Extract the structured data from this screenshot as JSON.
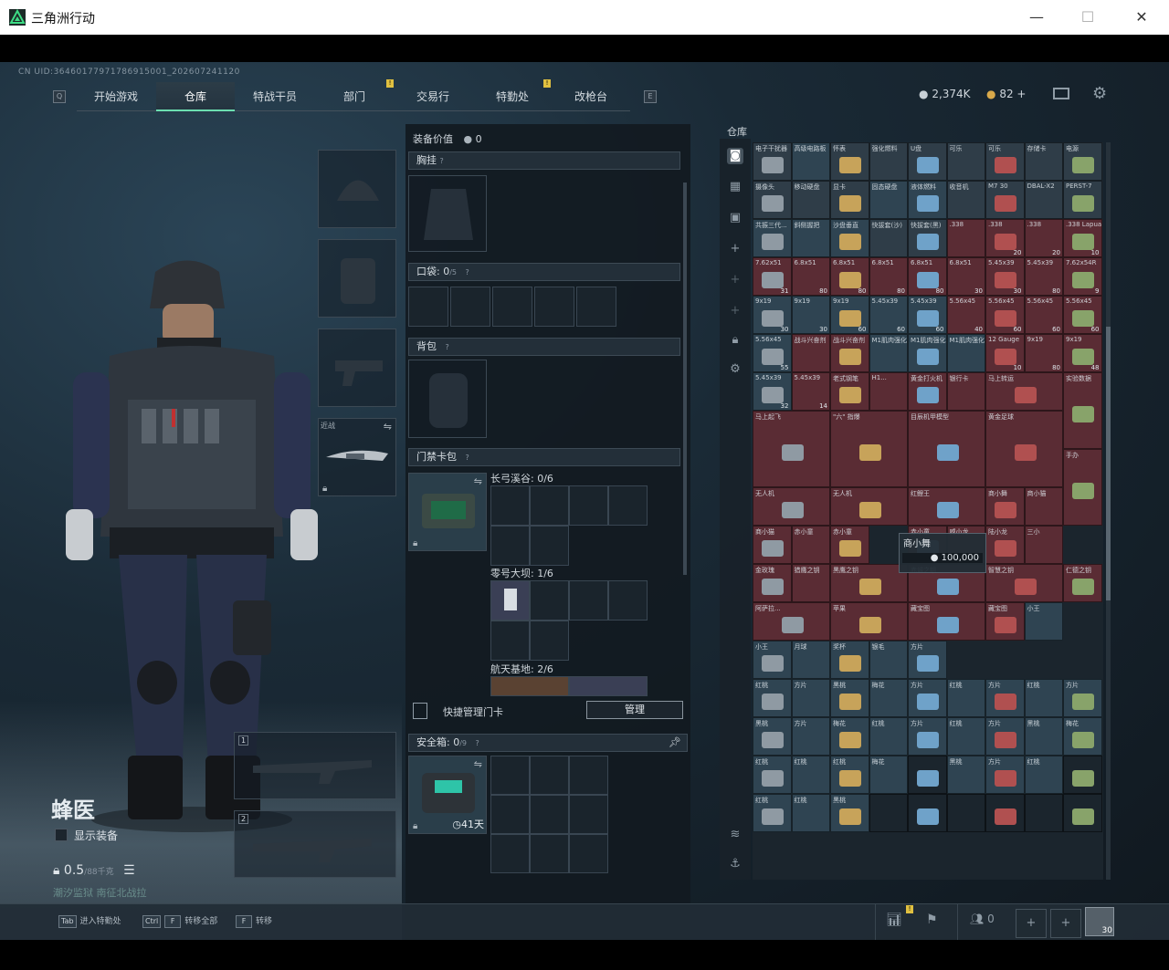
{
  "window": {
    "title": "三角洲行动",
    "minimize": "—",
    "maximize": "☐",
    "close": "✕"
  },
  "uid": "CN UID:36460177971786915001_202607241120",
  "nav": {
    "key_left": "Q",
    "key_right": "E",
    "tabs": [
      {
        "label": "开始游戏",
        "active": false
      },
      {
        "label": "仓库",
        "active": true
      },
      {
        "label": "特战干员",
        "active": false
      },
      {
        "label": "部门",
        "active": false
      },
      {
        "label": "交易行",
        "active": false
      },
      {
        "label": "特勤处",
        "active": false
      },
      {
        "label": "改枪台",
        "active": false
      }
    ],
    "badge": "!"
  },
  "currency": {
    "coins": "2,374K",
    "tickets": "82",
    "plus": "+"
  },
  "operator": {
    "name": "蜂医",
    "show_equipment": "显示装备",
    "weight": "0.5",
    "weight_max": "/88千克",
    "map": "潮汐监狱",
    "map2": "南征北战拉"
  },
  "equipment": {
    "melee_label": "近战",
    "slot1": "1",
    "slot2": "2"
  },
  "mid": {
    "value_label": "装备价值",
    "value": "0",
    "chest": "胸挂",
    "pocket": "口袋:",
    "pocket_count": "0",
    "pocket_max": "/5",
    "backpack": "背包",
    "keycard": "门禁卡包",
    "grids": [
      {
        "label": "长弓溪谷: 0/6"
      },
      {
        "label": "零号大坝: 1/6"
      },
      {
        "label": "航天基地: 2/6"
      }
    ],
    "quick_manage": "快捷管理门卡",
    "manage_btn": "管理",
    "safe": "安全箱:",
    "safe_count": "0",
    "safe_max": "/9",
    "safe_days": "41天"
  },
  "storage": {
    "label": "仓库",
    "tooltip_name": "商小舞",
    "tooltip_value": "100,000",
    "rows": [
      [
        {
          "n": "电子干扰器",
          "c": "#2f3d48"
        },
        {
          "n": "高级电路板",
          "c": "#2f4452"
        },
        {
          "n": "怀表",
          "c": "#2f3d48"
        },
        {
          "n": "强化燃料",
          "c": "#2f3d48"
        },
        {
          "n": "U盘",
          "c": "#2f3d48"
        },
        {
          "n": "可乐",
          "c": "#2f3d48"
        },
        {
          "n": "可乐",
          "c": "#2f3d48"
        },
        {
          "n": "存储卡",
          "c": "#2f3d48"
        },
        {
          "n": "电源",
          "c": "#2f3d48"
        }
      ],
      [
        {
          "n": "摄像头",
          "c": "#2f3d48"
        },
        {
          "n": "移动硬盘",
          "c": "#2f3d48"
        },
        {
          "n": "显卡",
          "c": "#2f3d48"
        },
        {
          "n": "固态硬盘",
          "c": "#2f4452"
        },
        {
          "n": "液体燃料",
          "c": "#2f4452"
        },
        {
          "n": "收音机",
          "c": "#2f3d48"
        },
        {
          "n": "M7 30",
          "c": "#2f3d48"
        },
        {
          "n": "DBAL-X2",
          "c": "#2f3d48"
        },
        {
          "n": "PERST-7",
          "c": "#2f3d48"
        }
      ],
      [
        {
          "n": "共振三代...",
          "c": "#2f4452"
        },
        {
          "n": "斜侧握把",
          "c": "#2f4452"
        },
        {
          "n": "沙盘垂直",
          "c": "#2f4452"
        },
        {
          "n": "快拔套(沙)",
          "c": "#2f3d48"
        },
        {
          "n": "快拔套(黑)",
          "c": "#2f3d48"
        },
        {
          "n": ".338",
          "c": "#5a2c34"
        },
        {
          "n": ".338",
          "c": "#5a2c34"
        },
        {
          "n": ".338",
          "c": "#5a2c34"
        },
        {
          "n": ".338 Lapua",
          "c": "#5a2c34"
        }
      ],
      [
        {
          "n": "7.62x51",
          "c": "#5a2c34"
        },
        {
          "n": "6.8x51",
          "c": "#5a2c34"
        },
        {
          "n": "6.8x51",
          "c": "#5a2c34"
        },
        {
          "n": "6.8x51",
          "c": "#5a2c34"
        },
        {
          "n": "6.8x51",
          "c": "#5a2c34"
        },
        {
          "n": "6.8x51",
          "c": "#5a2c34"
        },
        {
          "n": "5.45x39",
          "c": "#5a2c34"
        },
        {
          "n": "5.45x39",
          "c": "#5a2c34"
        },
        {
          "n": "7.62x54R",
          "c": "#5a2c34"
        }
      ],
      [
        {
          "n": "9x19",
          "c": "#2f4452"
        },
        {
          "n": "9x19",
          "c": "#2f4452"
        },
        {
          "n": "9x19",
          "c": "#2f4452"
        },
        {
          "n": "5.45x39",
          "c": "#2f4452"
        },
        {
          "n": "5.45x39",
          "c": "#2f4452"
        },
        {
          "n": "5.56x45",
          "c": "#5a2c34"
        },
        {
          "n": "5.56x45",
          "c": "#5a2c34"
        },
        {
          "n": "5.56x45",
          "c": "#5a2c34"
        },
        {
          "n": "5.56x45",
          "c": "#5a2c34"
        }
      ],
      [
        {
          "n": "5.56x45",
          "c": "#2f4452"
        },
        {
          "n": "战斗兴奋剂",
          "c": "#5a2c34"
        },
        {
          "n": "战斗兴奋剂",
          "c": "#5a2c34"
        },
        {
          "n": "M1肌肉强化",
          "c": "#2f4452"
        },
        {
          "n": "M1肌肉强化",
          "c": "#2f4452"
        },
        {
          "n": "M1肌肉强化",
          "c": "#2f4452"
        },
        {
          "n": "12 Gauge",
          "c": "#5a2c34"
        },
        {
          "n": "9x19",
          "c": "#5a2c34"
        },
        {
          "n": "9x19",
          "c": "#5a2c34"
        }
      ]
    ],
    "counts": [
      "",
      "",
      "",
      "",
      "",
      "",
      "",
      "",
      "",
      "",
      "",
      "",
      "",
      "",
      "",
      "",
      "",
      "",
      "",
      "",
      "",
      "",
      "",
      "",
      "20",
      "20",
      "10",
      "31",
      "80",
      "80",
      "80",
      "80",
      "30",
      "30",
      "80",
      "9",
      "30",
      "30",
      "60",
      "60",
      "60",
      "40",
      "60",
      "60",
      "60",
      "55",
      "",
      "",
      "",
      "",
      "",
      "10",
      "80",
      "48"
    ],
    "big": [
      {
        "n": "5.45x39",
        "c": "#2f4452",
        "ct": "32"
      },
      {
        "n": "5.45x39",
        "c": "#5a2c34",
        "ct": "14"
      },
      {
        "n": "老式钢笔",
        "c": "#5a2c34"
      },
      {
        "n": "H1...",
        "c": "#5a2c34"
      },
      {
        "n": "黄金打火机",
        "c": "#5a2c34"
      },
      {
        "n": "银行卡",
        "c": "#5a2c34"
      },
      {
        "n": "马上转运",
        "c": "#5a2c34"
      },
      {
        "n": "实验数据",
        "c": "#5a2c34"
      },
      {
        "n": "马上起飞",
        "c": "#5a2c34"
      },
      {
        "n": "\"六\" 指爆",
        "c": "#5a2c34"
      },
      {
        "n": "目辰机甲模型",
        "c": "#5a2c34"
      },
      {
        "n": "黄金足球",
        "c": "#5a2c34"
      },
      {
        "n": "手办",
        "c": "#5a2c34"
      },
      {
        "n": "无人机",
        "c": "#5a2c34"
      },
      {
        "n": "无人机",
        "c": "#5a2c34"
      },
      {
        "n": "红鲤王",
        "c": "#5a2c34"
      },
      {
        "n": "商小舞",
        "c": "#5a2c34"
      },
      {
        "n": "商小猫",
        "c": "#5a2c34"
      },
      {
        "n": "商小猫",
        "c": "#5a2c34"
      },
      {
        "n": "赤小童",
        "c": "#5a2c34"
      },
      {
        "n": "赤小童",
        "c": "#5a2c34"
      },
      {
        "n": "赤小童",
        "c": "#5a2c34"
      },
      {
        "n": "威小龙",
        "c": "#5a2c34"
      },
      {
        "n": "陆小龙",
        "c": "#5a2c34"
      },
      {
        "n": "三小",
        "c": "#5a2c34"
      },
      {
        "n": "金玫瑰",
        "c": "#5a2c34"
      },
      {
        "n": "猎鹰之钥",
        "c": "#5a2c34"
      },
      {
        "n": "黑鹰之钥",
        "c": "#5a2c34"
      },
      {
        "n": "赤诚之钥",
        "c": "#5a2c34"
      },
      {
        "n": "智慧之钥",
        "c": "#5a2c34"
      },
      {
        "n": "仁德之钥",
        "c": "#5a2c34"
      },
      {
        "n": "阿萨拉...",
        "c": "#5a2c34"
      },
      {
        "n": "苹果",
        "c": "#5a2c34"
      },
      {
        "n": "藏宝图",
        "c": "#5a2c34"
      },
      {
        "n": "藏宝图",
        "c": "#5a2c34"
      },
      {
        "n": "小王",
        "c": "#2f4452"
      },
      {
        "n": "小王",
        "c": "#2f4452"
      },
      {
        "n": "月球",
        "c": "#2f4452"
      },
      {
        "n": "奖杯",
        "c": "#2f4452"
      },
      {
        "n": "银毛",
        "c": "#2f4452"
      },
      {
        "n": "方片",
        "c": "#2f4452"
      }
    ],
    "card_rows": [
      [
        "红桃",
        "方片",
        "黑桃",
        "梅花",
        "方片",
        "红桃",
        "方片",
        "红桃",
        "方片"
      ],
      [
        "黑桃",
        "方片",
        "梅花",
        "红桃",
        "方片",
        "红桃",
        "方片",
        "黑桃",
        "梅花"
      ],
      [
        "红桃",
        "红桃",
        "红桃",
        "梅花",
        "",
        "黑桃",
        "方片",
        "红桃",
        ""
      ],
      [
        "红桃",
        "红桃",
        "黑桃",
        "",
        "",
        "",
        "",
        "",
        ""
      ]
    ]
  },
  "bottom": {
    "h1_key": "Tab",
    "h1": "进入特勤处",
    "h2_key": "Ctrl",
    "h2_key2": "F",
    "h2": "转移全部",
    "h3_key": "F",
    "h3": "转移",
    "friends": "0",
    "level": "30"
  },
  "colors": {
    "accent": "#6cdfb0",
    "red_bg": "#5a2c34",
    "blue_bg": "#2f4452"
  }
}
